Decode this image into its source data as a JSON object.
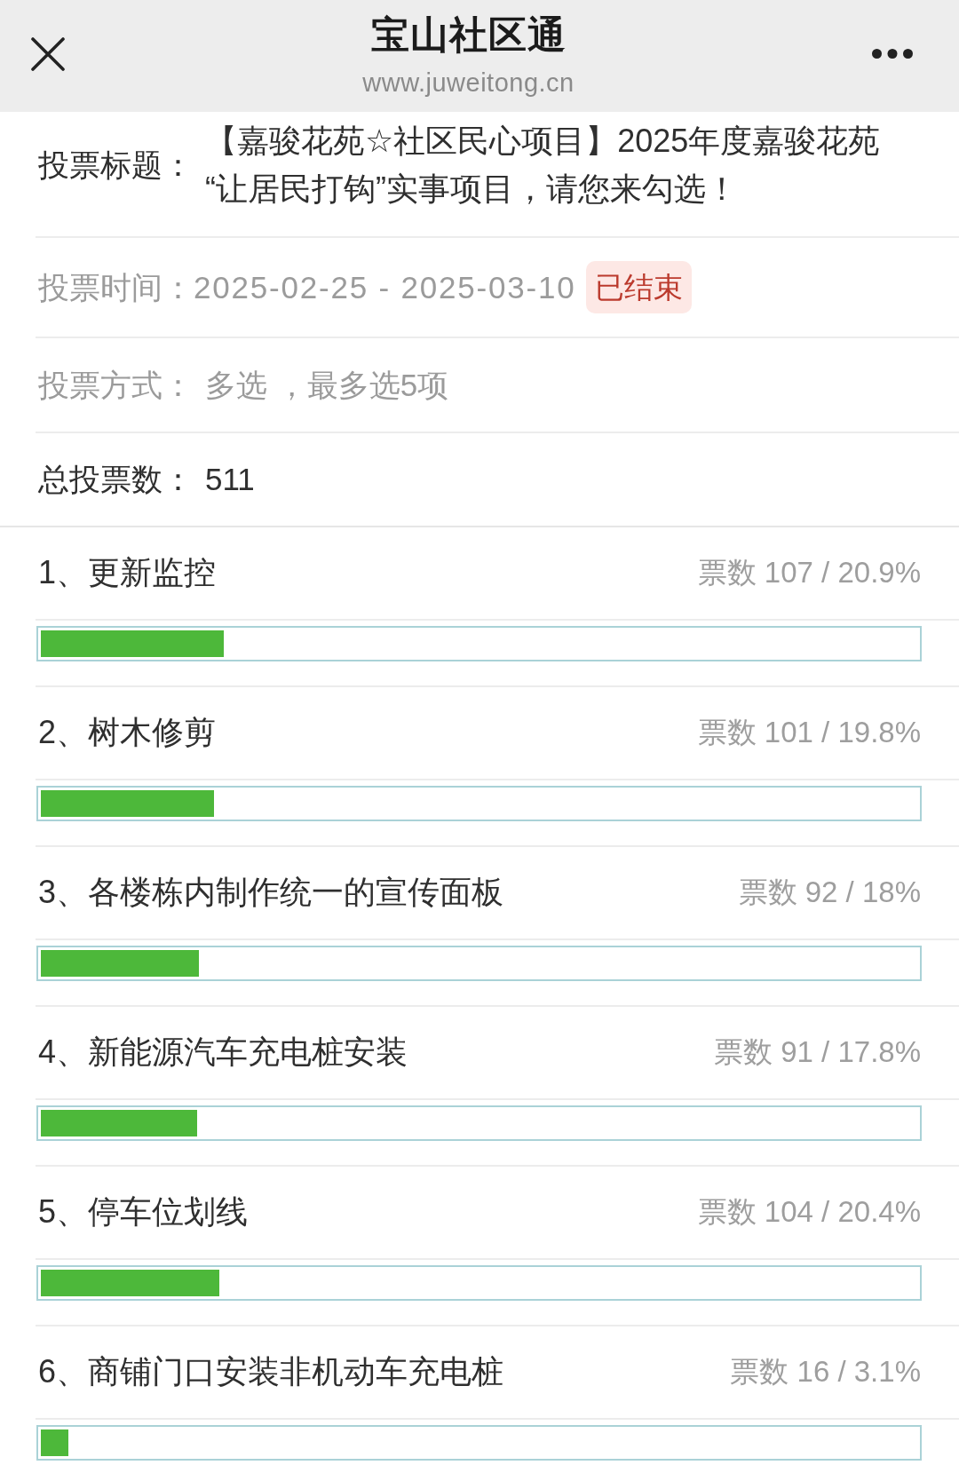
{
  "top_bar": {
    "title": "宝山社区通",
    "url": "www.juweitong.cn"
  },
  "vote_title": {
    "label": "投票标题：",
    "value": "【嘉骏花苑☆社区民心项目】2025年度嘉骏花苑“让居民打钩”实事项目，请您来勾选！"
  },
  "vote_time": {
    "label": "投票时间：",
    "value": "2025-02-25 - 2025-03-10",
    "status": {
      "text": "已结束",
      "kind": "ended"
    }
  },
  "vote_method": {
    "label": "投票方式：",
    "value": "多选 ，最多选5项"
  },
  "total_votes": {
    "label": "总投票数：",
    "value": "511"
  },
  "options": [
    {
      "label": "1、更新监控",
      "votes": "票数 107 / 20.9%",
      "level": 0.209
    },
    {
      "label": "2、树木修剪",
      "votes": "票数 101 / 19.8%",
      "level": 0.198
    },
    {
      "label": "3、各楼栋内制作统一的宣传面板",
      "votes": "票数 92 / 18%",
      "level": 0.18
    },
    {
      "label": "4、新能源汽车充电桩安装",
      "votes": "票数 91 / 17.8%",
      "level": 0.178
    },
    {
      "label": "5、停车位划线",
      "votes": "票数 104 / 20.4%",
      "level": 0.204
    },
    {
      "label": "6、商铺门口安装非机动车充电桩",
      "votes": "票数 16 / 3.1%",
      "level": 0.031
    }
  ]
}
